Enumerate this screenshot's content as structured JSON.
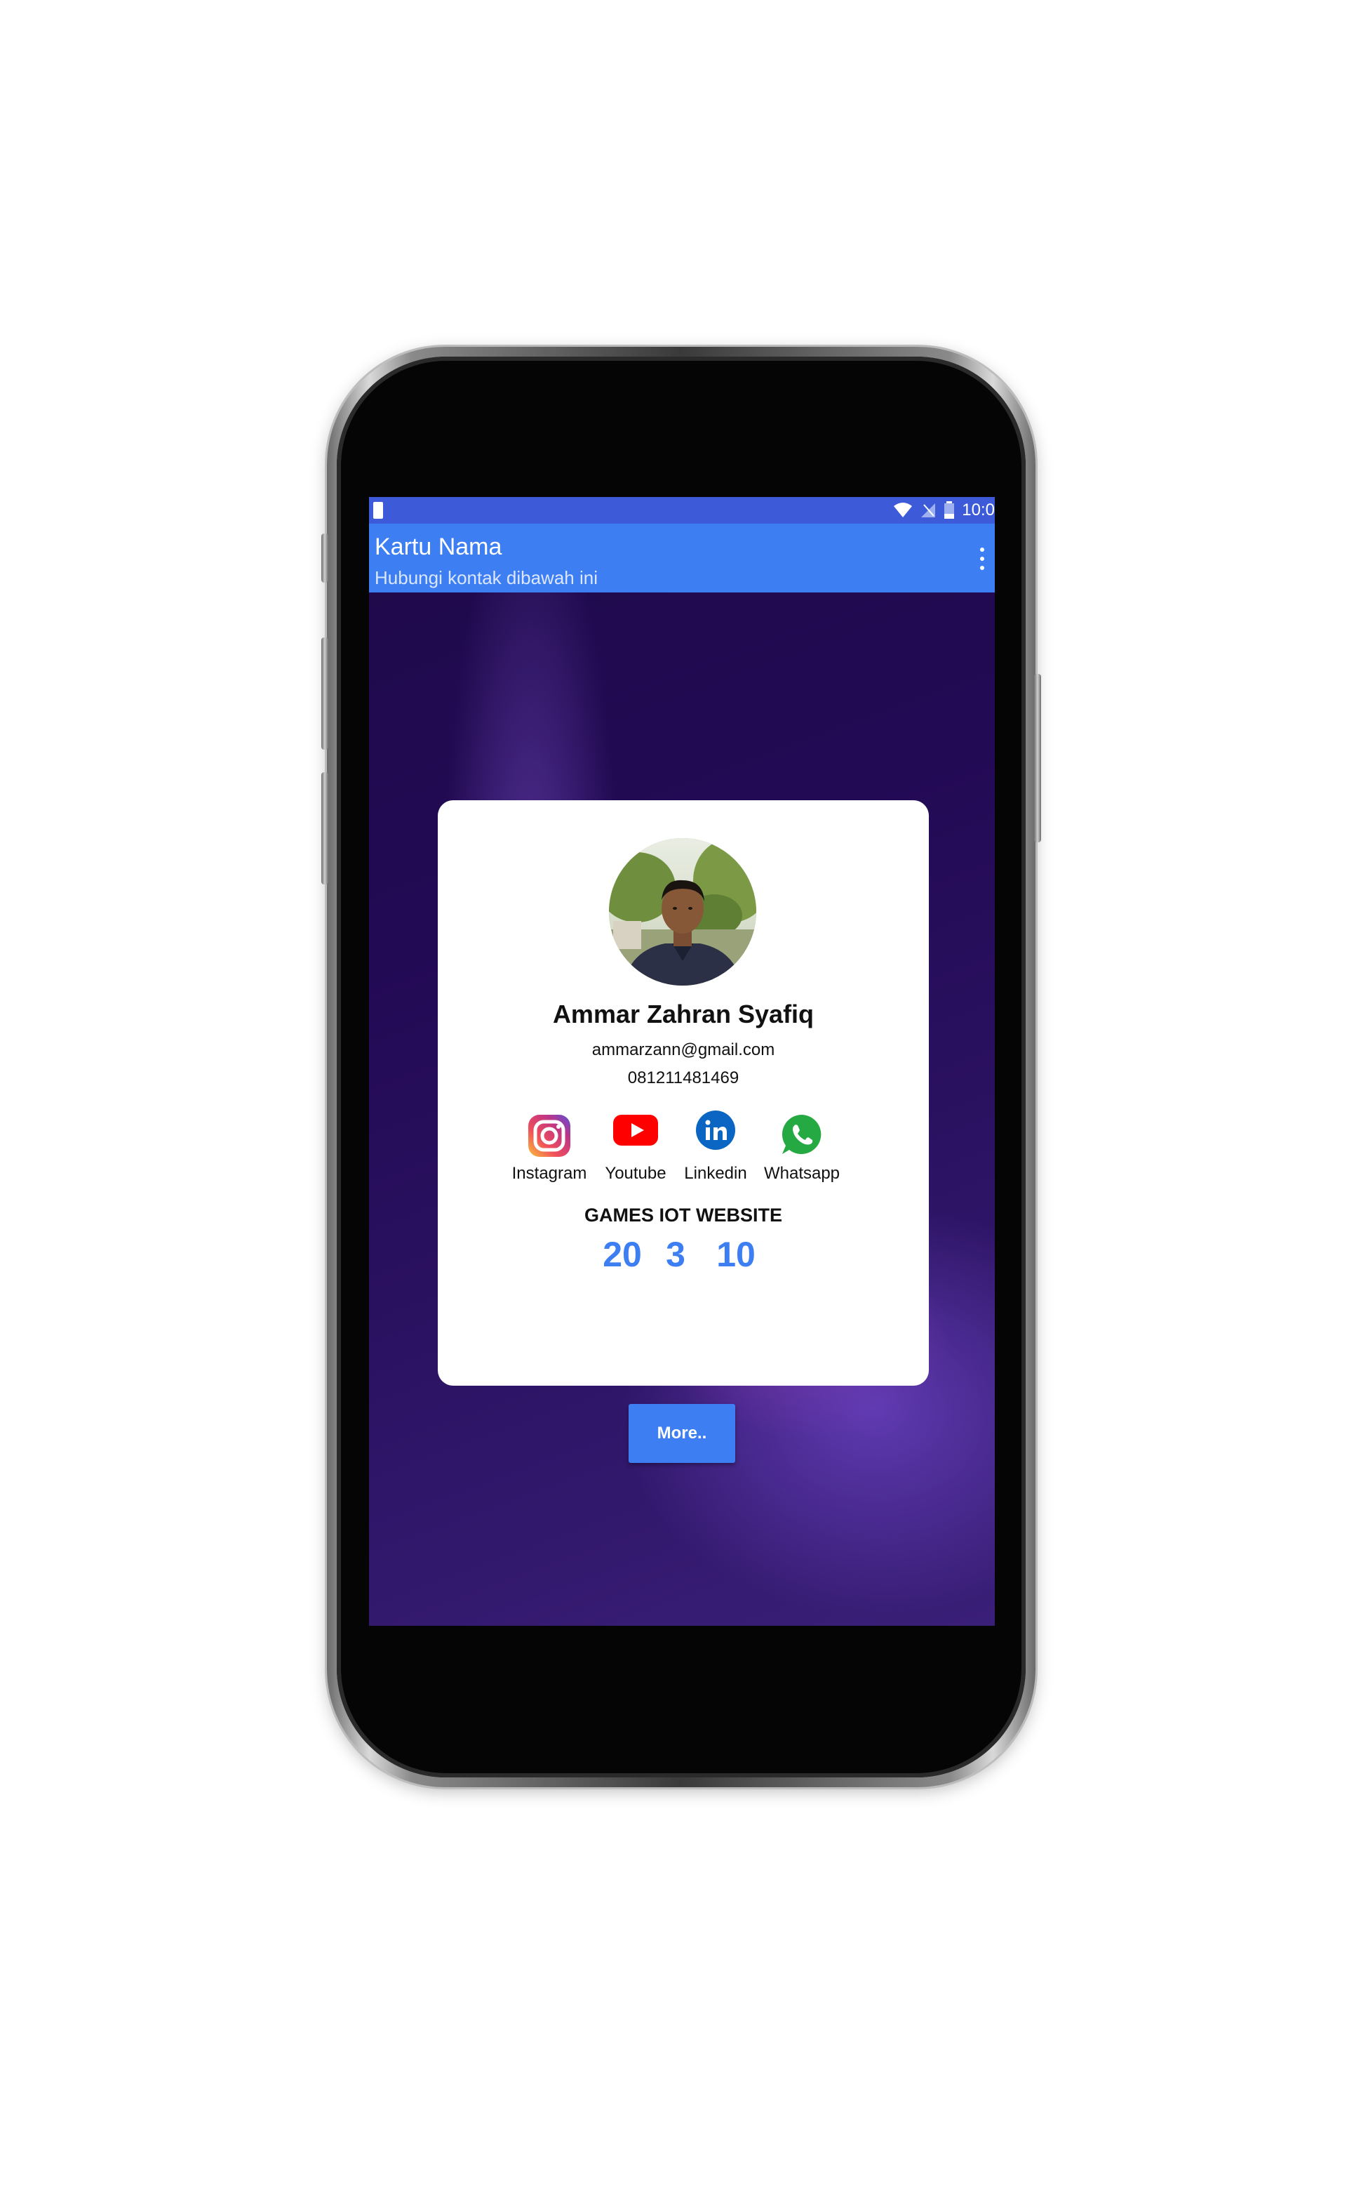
{
  "status_bar": {
    "time": "10:0"
  },
  "app_bar": {
    "title": "Kartu Nama",
    "subtitle": "Hubungi kontak dibawah ini"
  },
  "profile": {
    "name": "Ammar Zahran Syafiq",
    "email": "ammarzann@gmail.com",
    "phone": "081211481469"
  },
  "socials": [
    {
      "label": "Instagram",
      "icon": "instagram-icon"
    },
    {
      "label": "Youtube",
      "icon": "youtube-icon"
    },
    {
      "label": "Linkedin",
      "icon": "linkedin-icon"
    },
    {
      "label": "Whatsapp",
      "icon": "whatsapp-icon"
    }
  ],
  "stats": {
    "title": "GAMES IOT WEBSITE",
    "values": [
      "20",
      "3",
      "10"
    ]
  },
  "more_button": {
    "label": "More.."
  },
  "colors": {
    "status_bar": "#3d5bd9",
    "app_bar": "#3d7ff2",
    "accent": "#3d7ff2",
    "card": "#ffffff"
  }
}
